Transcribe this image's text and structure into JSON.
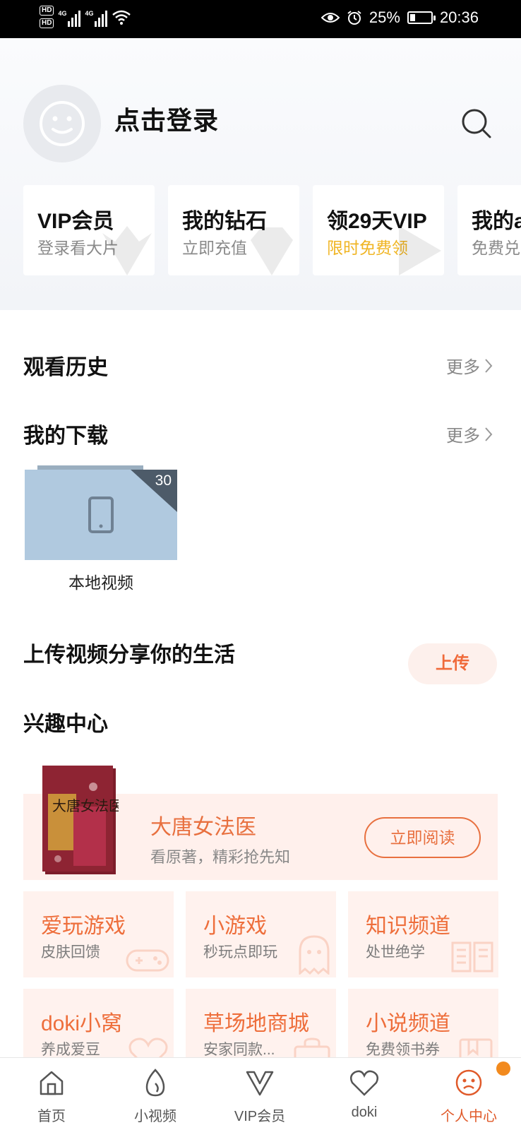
{
  "status_bar": {
    "hd1": "HD",
    "hd2": "HD",
    "net1": "4G",
    "net2": "4G",
    "battery": "25%",
    "battery_level": 0.25,
    "time": "20:36"
  },
  "header": {
    "login_label": "点击登录",
    "cards": [
      {
        "title": "VIP会员",
        "subtitle": "登录看大片",
        "accent": false
      },
      {
        "title": "我的钻石",
        "subtitle": "立即充值",
        "accent": false
      },
      {
        "title": "领29天VIP",
        "subtitle": "限时免费领",
        "accent": true
      },
      {
        "title": "我的a",
        "subtitle": "免费兑",
        "accent": false
      }
    ]
  },
  "history": {
    "title": "观看历史",
    "more": "更多"
  },
  "downloads": {
    "title": "我的下载",
    "more": "更多",
    "count": "30",
    "label": "本地视频"
  },
  "upload": {
    "title": "上传视频分享你的生活",
    "button": "上传"
  },
  "interest": {
    "title": "兴趣中心",
    "promo": {
      "title": "大唐女法医",
      "subtitle": "看原著，精彩抢先知",
      "button": "立即阅读",
      "book_text": "大唐女法医"
    },
    "tiles": [
      {
        "title": "爱玩游戏",
        "subtitle": "皮肤回馈",
        "icon": "gamepad-icon"
      },
      {
        "title": "小游戏",
        "subtitle": "秒玩点即玩",
        "icon": "ghost-icon"
      },
      {
        "title": "知识频道",
        "subtitle": "处世绝学",
        "icon": "open-book-icon"
      },
      {
        "title": "doki小窝",
        "subtitle": "养成爱豆",
        "icon": "doki-heart-icon"
      },
      {
        "title": "草场地商城",
        "subtitle": "安家同款...",
        "icon": "shopping-bag-icon"
      },
      {
        "title": "小说频道",
        "subtitle": "免费领书券",
        "icon": "bookmark-book-icon"
      }
    ]
  },
  "bottom_nav": {
    "items": [
      {
        "label": "首页"
      },
      {
        "label": "小视频"
      },
      {
        "label": "VIP会员"
      },
      {
        "label": "doki"
      },
      {
        "label": "个人中心"
      }
    ]
  },
  "colors": {
    "accent": "#ee6e3b",
    "gold": "#f0b524",
    "notify_dot": "#f28a1e"
  }
}
